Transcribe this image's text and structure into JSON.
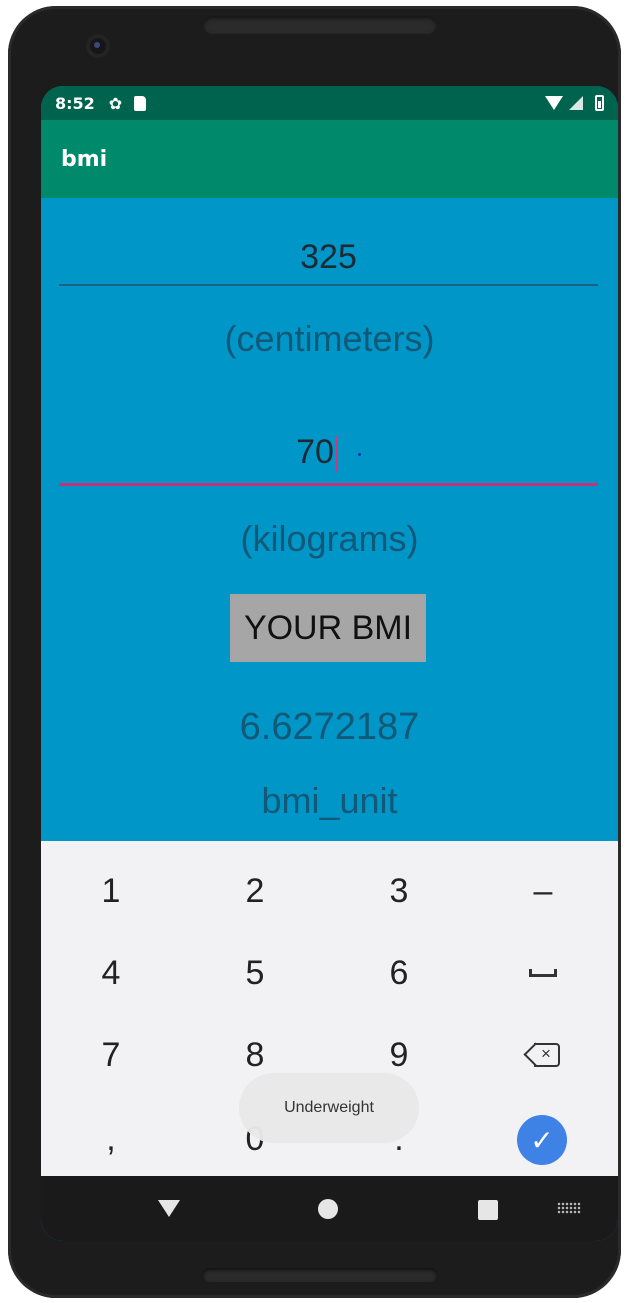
{
  "status_bar": {
    "time": "8:52",
    "settings_icon": "gear-icon",
    "sd_icon": "sd-card-icon",
    "wifi_icon": "wifi-icon",
    "signal_icon": "signal-icon",
    "battery_icon": "battery-icon"
  },
  "app_bar": {
    "title": "bmi"
  },
  "form": {
    "height_value": "325",
    "height_unit": "(centimeters)",
    "weight_value": "70",
    "weight_unit": "(kilograms)",
    "calculate_label": "YOUR BMI",
    "result_value": "6.6272187",
    "result_unit": "bmi_unit"
  },
  "keyboard": {
    "keys": [
      "1",
      "2",
      "3",
      "–",
      "4",
      "5",
      "6",
      "space",
      "7",
      "8",
      "9",
      "backspace",
      ",",
      "0",
      ".",
      "done"
    ],
    "dash_label": "–",
    "comma_label": ",",
    "dot_label": "."
  },
  "toast": {
    "message": "Underweight"
  },
  "colors": {
    "status_bar": "#00634e",
    "app_bar": "#008a6c",
    "background": "#0096c8",
    "button": "#a6a6a6",
    "done_button": "#3f82e6"
  }
}
